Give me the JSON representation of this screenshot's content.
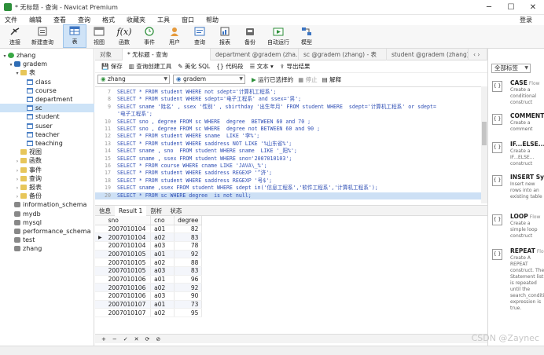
{
  "window": {
    "title": "* 无标题 - 查询 - Navicat Premium",
    "min": "─",
    "max": "☐",
    "close": "✕"
  },
  "menu": {
    "items": [
      "文件",
      "编辑",
      "查看",
      "查询",
      "格式",
      "收藏夹",
      "工具",
      "窗口",
      "帮助"
    ],
    "login": "登录"
  },
  "toolbar": [
    {
      "label": "连接",
      "icon": "connect-icon"
    },
    {
      "label": "新建查询",
      "icon": "new-query-icon"
    },
    {
      "label": "表",
      "icon": "table-icon"
    },
    {
      "label": "视图",
      "icon": "view-icon"
    },
    {
      "label": "函数",
      "icon": "function-icon"
    },
    {
      "label": "事件",
      "icon": "event-icon"
    },
    {
      "label": "用户",
      "icon": "user-icon"
    },
    {
      "label": "查询",
      "icon": "query-icon"
    },
    {
      "label": "报表",
      "icon": "report-icon"
    },
    {
      "label": "备份",
      "icon": "backup-icon"
    },
    {
      "label": "自动运行",
      "icon": "automation-icon"
    },
    {
      "label": "模型",
      "icon": "model-icon"
    }
  ],
  "tree": [
    {
      "label": "zhang",
      "type": "conn",
      "arr": "▾"
    },
    {
      "label": "gradem",
      "type": "db",
      "arr": "▾"
    },
    {
      "label": "表",
      "type": "fold",
      "arr": "▾"
    },
    {
      "label": "class",
      "type": "tbl",
      "arr": ""
    },
    {
      "label": "course",
      "type": "tbl",
      "arr": ""
    },
    {
      "label": "department",
      "type": "tbl",
      "arr": ""
    },
    {
      "label": "sc",
      "type": "tbl",
      "arr": "",
      "selected": true
    },
    {
      "label": "student",
      "type": "tbl",
      "arr": ""
    },
    {
      "label": "suser",
      "type": "tbl",
      "arr": ""
    },
    {
      "label": "teacher",
      "type": "tbl",
      "arr": ""
    },
    {
      "label": "teaching",
      "type": "tbl",
      "arr": ""
    },
    {
      "label": "视图",
      "type": "fold",
      "arr": ""
    },
    {
      "label": "函数",
      "type": "fold",
      "arr": "›"
    },
    {
      "label": "事件",
      "type": "fold",
      "arr": "›"
    },
    {
      "label": "查询",
      "type": "fold",
      "arr": "›"
    },
    {
      "label": "报表",
      "type": "fold",
      "arr": "›"
    },
    {
      "label": "备份",
      "type": "fold",
      "arr": "›"
    },
    {
      "label": "information_schema",
      "type": "gray",
      "arr": ""
    },
    {
      "label": "mydb",
      "type": "gray",
      "arr": ""
    },
    {
      "label": "mysql",
      "type": "gray",
      "arr": ""
    },
    {
      "label": "performance_schema",
      "type": "gray",
      "arr": ""
    },
    {
      "label": "test",
      "type": "gray",
      "arr": ""
    },
    {
      "label": "zhang",
      "type": "gray",
      "arr": ""
    }
  ],
  "tabs": [
    "对象",
    "* 无标题 - 查询",
    "department @gradem (zha...",
    "sc @gradem (zhang) - 表",
    "student @gradem (zhang) - ...",
    "‹  ›"
  ],
  "query_toolbar": [
    "保存",
    "查询创建工具",
    "美化 SQL",
    "代码段",
    "文本",
    "导出结果"
  ],
  "connection_select": "zhang",
  "database_select": "gradem",
  "run_buttons": [
    "运行已选择的",
    "停止",
    "解释"
  ],
  "code_lines": [
    {
      "n": "7",
      "t": "SELECT * FROM student WHERE not sdept='计算机工程系';"
    },
    {
      "n": "8",
      "t": "SELECT * FROM student WHERE sdept='电子工程系' and ssex='男';"
    },
    {
      "n": "9",
      "t": "SELECT sname '姓名' , ssex '性别' , sbirthday '出生年月' FROM student WHERE  sdept='计算机工程系' or sdept="
    },
    {
      "n": "",
      "t": "'电子工程系';"
    },
    {
      "n": "10",
      "t": "SELECT sno , degree FROM sc WHERE  degree  BETWEEN 60 and 70 ;"
    },
    {
      "n": "11",
      "t": "SELECT sno , degree FROM sc WHERE  degree not BETWEEN 60 and 90 ;"
    },
    {
      "n": "12",
      "t": "SELECT * FROM student WHERE sname  LIKE '李%';"
    },
    {
      "n": "13",
      "t": "SELECT * FROM student WHERE saddress NOT LIKE '%山东省%';"
    },
    {
      "n": "14",
      "t": "SELECT sname , sno  FROM student WHERE sname  LIKE '_阳%';"
    },
    {
      "n": "15",
      "t": "SELECT sname , ssex FROM student WHERE sno='2007010103';"
    },
    {
      "n": "16",
      "t": "SELECT * FROM course WHERE cname LIKE 'JAVA\\_%';"
    },
    {
      "n": "17",
      "t": "SELECT * FROM student WHERE saddress REGEXP '^济';"
    },
    {
      "n": "18",
      "t": "SELECT * FROM student WHERE saddress REGEXP '号$';"
    },
    {
      "n": "19",
      "t": "SELECT sname ,ssex FROM student WHERE sdept in('信息工程系','软件工程系','计算机工程系');"
    },
    {
      "n": "20",
      "t": "SELECT * FROM sc WHERE degree  is not null;",
      "hl": true
    }
  ],
  "result_tabs": [
    "信息",
    "Result 1",
    "剖析",
    "状态"
  ],
  "grid": {
    "columns": [
      "sno",
      "cno",
      "degree"
    ],
    "rows": [
      [
        "2007010104",
        "a01",
        "82"
      ],
      [
        "2007010104",
        "a02",
        "83"
      ],
      [
        "2007010104",
        "a03",
        "78"
      ],
      [
        "2007010105",
        "a01",
        "92"
      ],
      [
        "2007010105",
        "a02",
        "88"
      ],
      [
        "2007010105",
        "a03",
        "83"
      ],
      [
        "2007010106",
        "a01",
        "96"
      ],
      [
        "2007010106",
        "a02",
        "92"
      ],
      [
        "2007010106",
        "a03",
        "90"
      ],
      [
        "2007010107",
        "a01",
        "73"
      ],
      [
        "2007010107",
        "a02",
        "95"
      ]
    ]
  },
  "grid_footer": [
    "+",
    "−",
    "✓",
    "✕",
    "⟳",
    "⊘"
  ],
  "right_panel": {
    "dropdown": "全部标签",
    "snippets": [
      {
        "name": "CASE",
        "tag": "Flow",
        "desc": "Create a conditional construct"
      },
      {
        "name": "COMMENT",
        "tag": "",
        "desc": "Create a comment"
      },
      {
        "name": "IF...ELSE...",
        "tag": "",
        "desc": "Create a IF...ELSE... construct"
      },
      {
        "name": "INSERT Sy",
        "tag": "",
        "desc": "Insert new rows into an existing table"
      },
      {
        "name": "LOOP",
        "tag": "Flow",
        "desc": "Create a simple loop construct"
      },
      {
        "name": "REPEAT",
        "tag": "Flow",
        "desc": "Create A REPEAT construct. The Statement list is repeated until the search_condition expression is true."
      }
    ]
  },
  "watermark": "CSDN @Zaynec"
}
